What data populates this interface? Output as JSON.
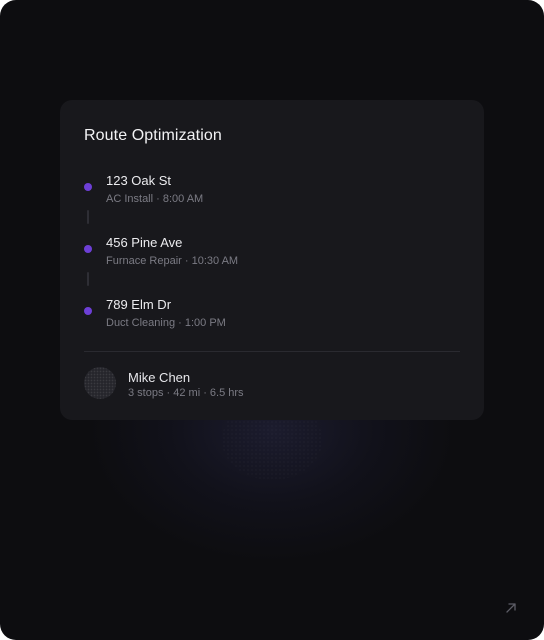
{
  "card": {
    "title": "Route Optimization",
    "stops": [
      {
        "address": "123 Oak St",
        "detail": "AC Install · 8:00 AM"
      },
      {
        "address": "456 Pine Ave",
        "detail": "Furnace Repair · 10:30 AM"
      },
      {
        "address": "789 Elm Dr",
        "detail": "Duct Cleaning · 1:00 PM"
      }
    ],
    "driver": {
      "name": "Mike Chen",
      "summary": "3 stops · 42 mi · 6.5 hrs"
    }
  },
  "icons": {
    "stop_marker": "route-stop-dot-icon",
    "expand": "arrow-up-right-icon"
  },
  "colors": {
    "background": "#0d0d10",
    "card": "#18181c",
    "accent": "#6d3fd6"
  }
}
